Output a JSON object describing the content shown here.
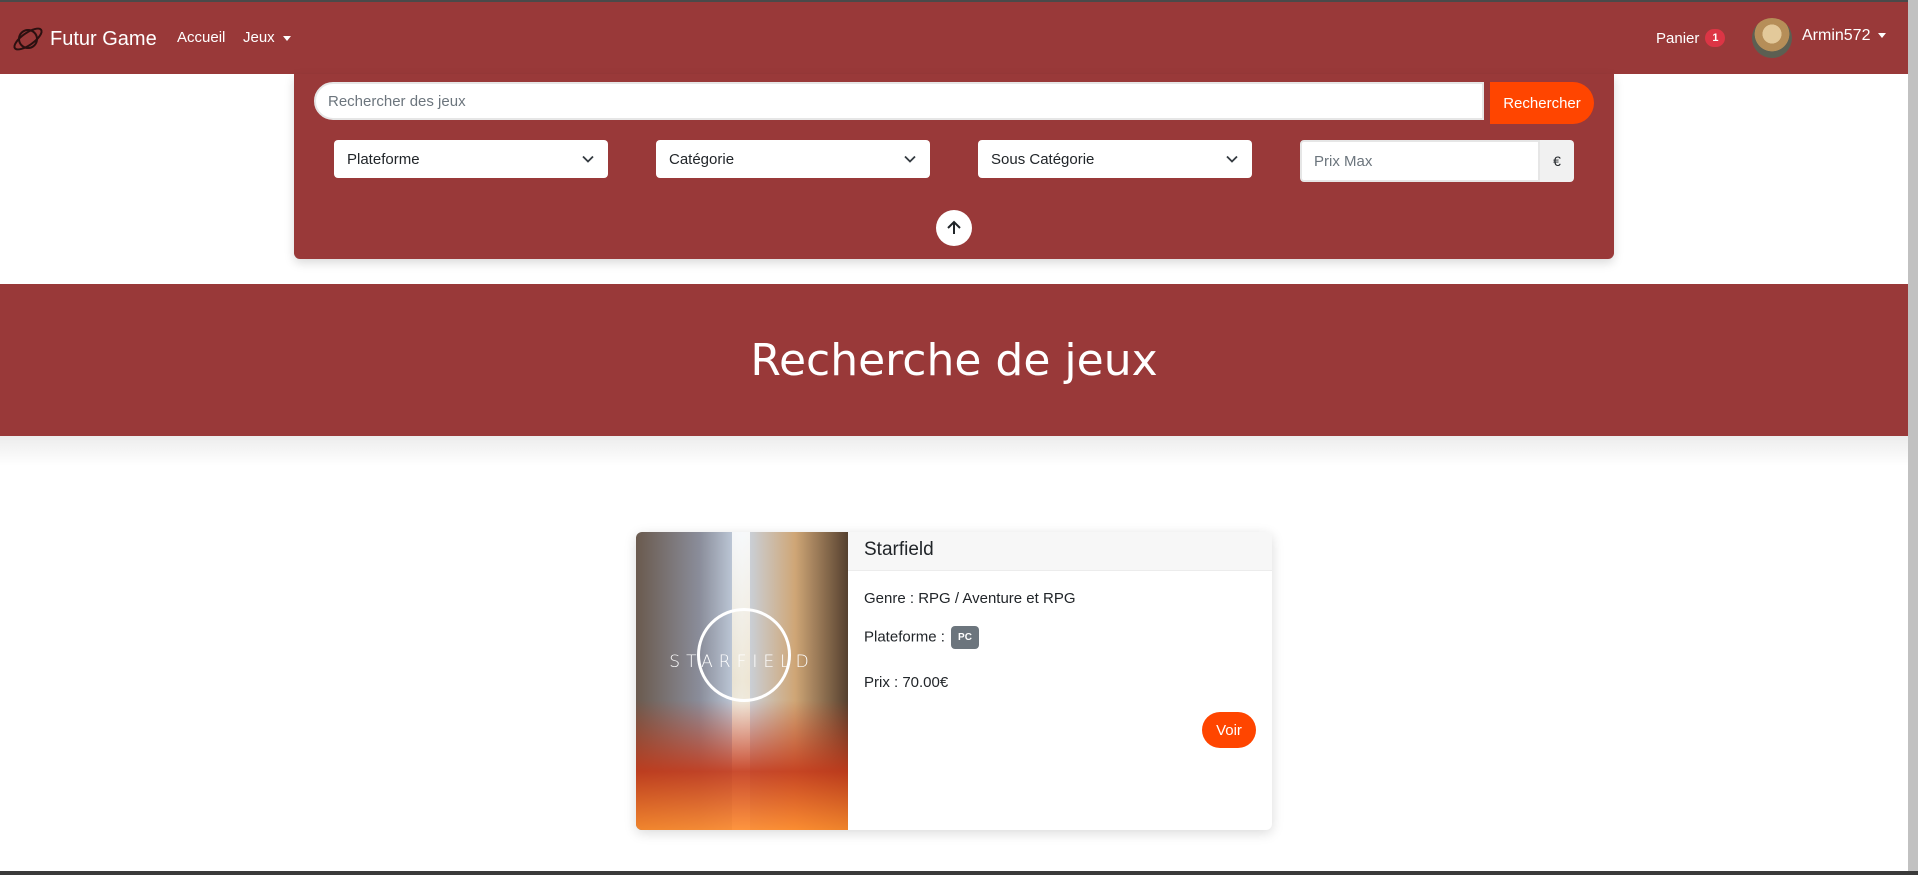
{
  "navbar": {
    "brand": "Futur Game",
    "links": [
      {
        "label": "Accueil"
      },
      {
        "label": "Jeux"
      }
    ],
    "cart_label": "Panier",
    "cart_count": "1",
    "username": "Armin572"
  },
  "search": {
    "placeholder": "Rechercher des jeux",
    "button_label": "Rechercher",
    "filters": {
      "platform": "Plateforme",
      "category": "Catégorie",
      "subcategory": "Sous Catégorie",
      "price_placeholder": "Prix Max",
      "currency": "€"
    }
  },
  "hero": {
    "title": "Recherche de jeux"
  },
  "results": [
    {
      "title": "Starfield",
      "cover_text": "STARFIELD",
      "genre": "Genre : RPG / Aventure et RPG",
      "platform_label": "Plateforme :",
      "platform_badge": "PC",
      "price": "Prix : 70.00€",
      "button_label": "Voir"
    }
  ],
  "colors": {
    "primary": "#993939",
    "accent": "#ff4500",
    "badge": "#dc3545"
  },
  "icons": {
    "brand": "planet-icon",
    "dropdown": "chevron-down-icon",
    "scroll_top": "arrow-up-icon"
  }
}
